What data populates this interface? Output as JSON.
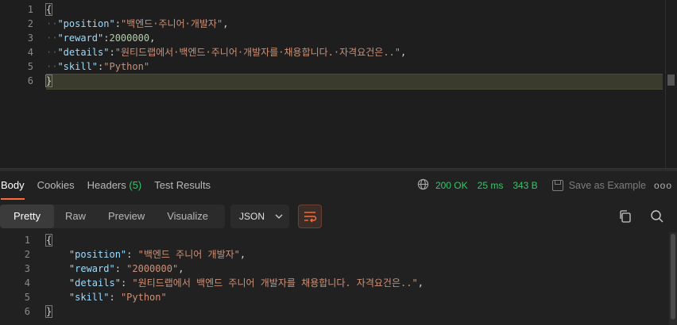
{
  "request_body": {
    "line_numbers": [
      "1",
      "2",
      "3",
      "4",
      "5",
      "6"
    ],
    "lines": [
      {
        "segments": [
          {
            "t": "brace",
            "v": "{"
          }
        ]
      },
      {
        "segments": [
          {
            "t": "ws",
            "v": "··"
          },
          {
            "t": "key",
            "v": "\"position\""
          },
          {
            "t": "punc",
            "v": ":"
          },
          {
            "t": "str",
            "v": "\"백엔드·주니어·개발자\""
          },
          {
            "t": "punc",
            "v": ","
          }
        ]
      },
      {
        "segments": [
          {
            "t": "ws",
            "v": "··"
          },
          {
            "t": "key",
            "v": "\"reward\""
          },
          {
            "t": "punc",
            "v": ":"
          },
          {
            "t": "num",
            "v": "2000000"
          },
          {
            "t": "punc",
            "v": ","
          }
        ]
      },
      {
        "segments": [
          {
            "t": "ws",
            "v": "··"
          },
          {
            "t": "key",
            "v": "\"details\""
          },
          {
            "t": "punc",
            "v": ":"
          },
          {
            "t": "str",
            "v": "\"원티드랩에서·백엔드·주니어·개발자를·채용합니다.·자격요건은..\""
          },
          {
            "t": "punc",
            "v": ","
          }
        ]
      },
      {
        "segments": [
          {
            "t": "ws",
            "v": "··"
          },
          {
            "t": "key",
            "v": "\"skill\""
          },
          {
            "t": "punc",
            "v": ":"
          },
          {
            "t": "str",
            "v": "\"Python\""
          }
        ]
      },
      {
        "segments": [
          {
            "t": "brace",
            "v": "}"
          }
        ]
      }
    ]
  },
  "response_tabs": [
    {
      "label": "Body",
      "active": true
    },
    {
      "label": "Cookies",
      "active": false
    },
    {
      "label": "Headers",
      "count": "(5)",
      "active": false
    },
    {
      "label": "Test Results",
      "active": false
    }
  ],
  "status": {
    "globe_icon": "globe-icon",
    "code": "200 OK",
    "time": "25 ms",
    "size": "343 B",
    "save_example": "Save as Example",
    "more": "ooo"
  },
  "view_modes": [
    {
      "label": "Pretty",
      "active": true
    },
    {
      "label": "Raw",
      "active": false
    },
    {
      "label": "Preview",
      "active": false
    },
    {
      "label": "Visualize",
      "active": false
    }
  ],
  "format": {
    "selected": "JSON"
  },
  "response_body": {
    "line_numbers": [
      "1",
      "2",
      "3",
      "4",
      "5",
      "6"
    ],
    "lines": [
      {
        "segments": [
          {
            "t": "brace",
            "v": "{"
          }
        ]
      },
      {
        "segments": [
          {
            "t": "punc",
            "v": "    "
          },
          {
            "t": "key",
            "v": "\"position\""
          },
          {
            "t": "punc",
            "v": ": "
          },
          {
            "t": "str",
            "v": "\"백엔드 주니어 개발자\""
          },
          {
            "t": "punc",
            "v": ","
          }
        ]
      },
      {
        "segments": [
          {
            "t": "punc",
            "v": "    "
          },
          {
            "t": "key",
            "v": "\"reward\""
          },
          {
            "t": "punc",
            "v": ": "
          },
          {
            "t": "str",
            "v": "\"2000000\""
          },
          {
            "t": "punc",
            "v": ","
          }
        ]
      },
      {
        "segments": [
          {
            "t": "punc",
            "v": "    "
          },
          {
            "t": "key",
            "v": "\"details\""
          },
          {
            "t": "punc",
            "v": ": "
          },
          {
            "t": "str",
            "v": "\"원티드랩에서 백엔드 주니어 개발자를 채용합니다. 자격요건은..\""
          },
          {
            "t": "punc",
            "v": ","
          }
        ]
      },
      {
        "segments": [
          {
            "t": "punc",
            "v": "    "
          },
          {
            "t": "key",
            "v": "\"skill\""
          },
          {
            "t": "punc",
            "v": ": "
          },
          {
            "t": "str",
            "v": "\"Python\""
          }
        ]
      },
      {
        "segments": [
          {
            "t": "brace",
            "v": "}"
          }
        ]
      }
    ]
  },
  "colors": {
    "accent": "#ff6c37",
    "ok": "#3ac46b",
    "key": "#9cdcfe",
    "string": "#ce9178",
    "number": "#b5cea8"
  }
}
